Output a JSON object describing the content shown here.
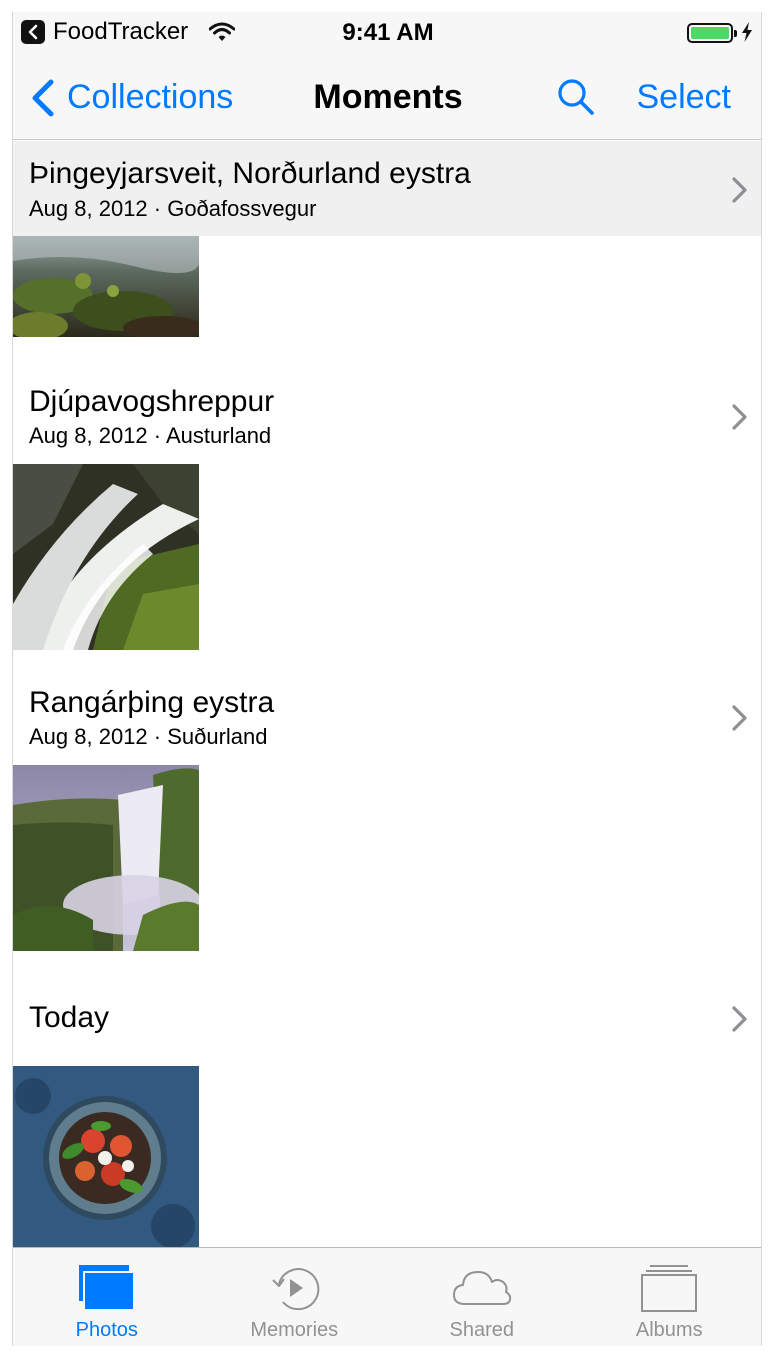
{
  "status_bar": {
    "back_app": "FoodTracker",
    "time": "9:41 AM",
    "battery_color": "#4cd964"
  },
  "nav": {
    "back_label": "Collections",
    "title": "Moments",
    "select_label": "Select",
    "accent_color": "#007aff"
  },
  "moments": [
    {
      "title": "Þingeyjarsveit, Norðurland eystra",
      "subtitle": "Aug 8, 2012 · Goðafossvegur",
      "thumbnail": "mossy-riverbank-photo"
    },
    {
      "title": "Djúpavogshreppur",
      "subtitle": "Aug 8, 2012 · Austurland",
      "thumbnail": "waterfall-rocks-photo"
    },
    {
      "title": "Rangárþing eystra",
      "subtitle": "Aug 8, 2012 · Suðurland",
      "thumbnail": "misty-waterfall-photo"
    },
    {
      "title": "Today",
      "subtitle": "",
      "thumbnail": "salad-bowl-photo"
    }
  ],
  "tabs": [
    {
      "label": "Photos",
      "icon": "photos-icon",
      "active": true
    },
    {
      "label": "Memories",
      "icon": "memories-icon",
      "active": false
    },
    {
      "label": "Shared",
      "icon": "cloud-icon",
      "active": false
    },
    {
      "label": "Albums",
      "icon": "albums-icon",
      "active": false
    }
  ]
}
